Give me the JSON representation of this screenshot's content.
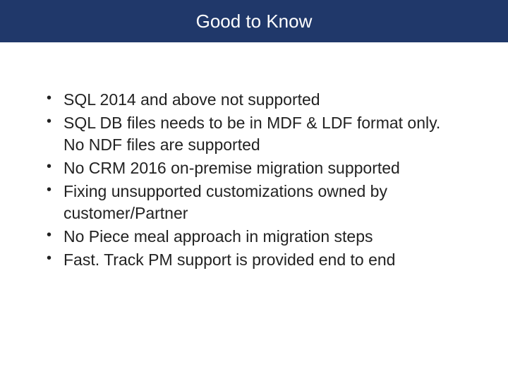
{
  "header": {
    "title": "Good to Know"
  },
  "bullets": {
    "items": [
      "SQL 2014 and above not supported",
      "SQL DB files needs to be in MDF & LDF format only. No NDF files are supported",
      "No CRM 2016 on-premise migration supported",
      "Fixing unsupported customizations owned by customer/Partner",
      "No Piece meal approach in migration steps",
      "Fast. Track PM support is provided end to end"
    ]
  }
}
